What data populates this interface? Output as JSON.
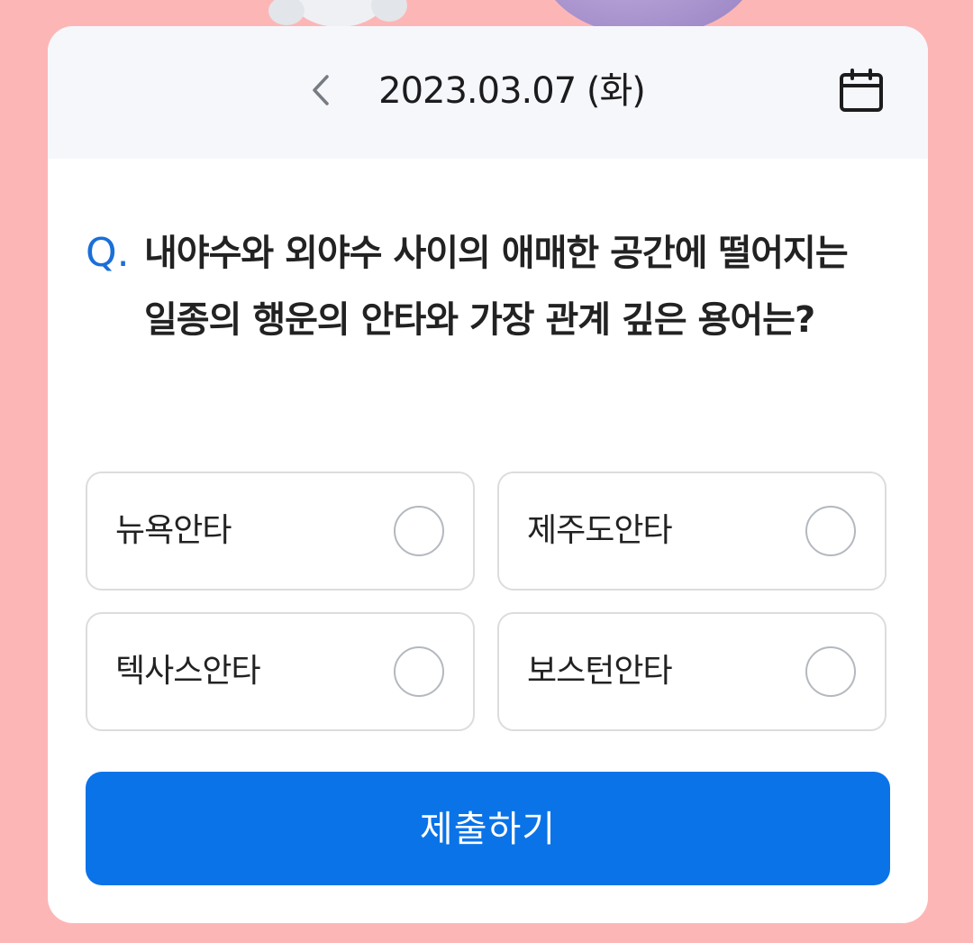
{
  "header": {
    "date": "2023.03.07 (화)",
    "prev_icon": "chevron-left-icon",
    "calendar_icon": "calendar-icon"
  },
  "quiz": {
    "q_prefix": "Q.",
    "question": "내야수와 외야수 사이의 애매한 공간에 떨어지는 일종의 행운의 안타와 가장 관계 깊은 용어는?",
    "options": [
      {
        "label": "뉴욕안타",
        "selected": false
      },
      {
        "label": "제주도안타",
        "selected": false
      },
      {
        "label": "텍사스안타",
        "selected": false
      },
      {
        "label": "보스턴안타",
        "selected": false
      }
    ],
    "submit_label": "제출하기"
  },
  "colors": {
    "background": "#fdb6b6",
    "accent": "#0a73e8",
    "header_bg": "#f6f7fb"
  }
}
